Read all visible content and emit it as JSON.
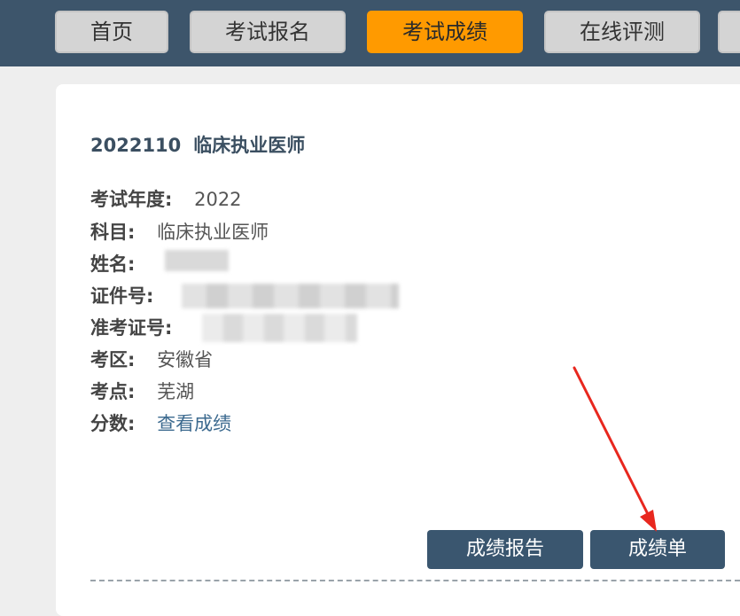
{
  "nav": {
    "items": [
      {
        "label": "首页"
      },
      {
        "label": "考试报名"
      },
      {
        "label": "考试成绩"
      },
      {
        "label": "在线评测"
      }
    ],
    "active_index": 2
  },
  "record": {
    "title_code": "2022110",
    "title_name": "临床执业医师",
    "fields": {
      "year": {
        "label": "考试年度:",
        "value": "2022"
      },
      "subject": {
        "label": "科目:",
        "value": "临床执业医师"
      },
      "name": {
        "label": "姓名:"
      },
      "id_number": {
        "label": "证件号:"
      },
      "admission_number": {
        "label": "准考证号:"
      },
      "exam_area": {
        "label": "考区:",
        "value": "安徽省"
      },
      "exam_site": {
        "label": "考点:",
        "value": "芜湖"
      },
      "score": {
        "label": "分数:",
        "link_text": "查看成绩"
      }
    }
  },
  "actions": {
    "report_label": "成绩报告",
    "sheet_label": "成绩单"
  },
  "colors": {
    "topbar": "#3d556b",
    "nav_active": "#ff9a00",
    "nav_inactive": "#d4d4d4",
    "button": "#3a566f",
    "link": "#3c6a8f",
    "annotation_arrow": "#e8271e"
  }
}
